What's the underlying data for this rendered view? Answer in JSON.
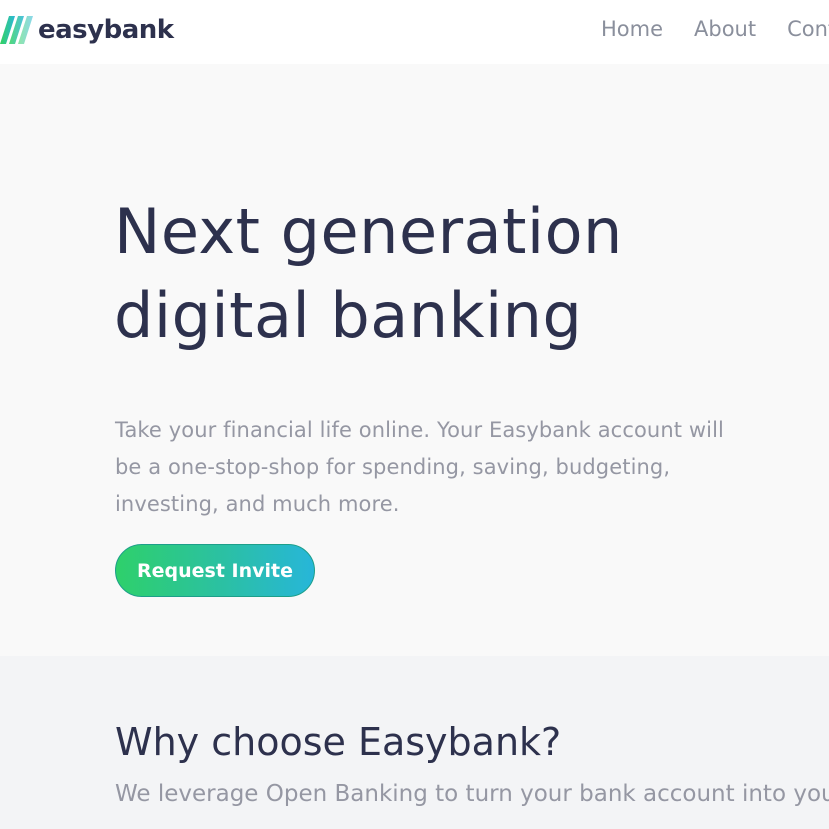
{
  "header": {
    "logo": {
      "text": "easybank",
      "icon": "logo-stripes-icon"
    },
    "nav": [
      "Home",
      "About",
      "Contact"
    ]
  },
  "hero": {
    "title_line1": "Next generation",
    "title_line2": "digital banking",
    "description_line1": "Take your financial life online. Your Easybank account will",
    "description_line2": "be a one-stop-shop for spending, saving, budgeting,",
    "description_line3": "investing, and much more.",
    "cta_label": "Request Invite"
  },
  "why": {
    "title": "Why choose Easybank?",
    "text": "We leverage Open Banking to turn your bank account into your"
  },
  "colors": {
    "brand_dark": "#2d314d",
    "accent_green": "#31d35c",
    "accent_cyan": "#2bb7da",
    "muted_text": "#9597a3"
  }
}
